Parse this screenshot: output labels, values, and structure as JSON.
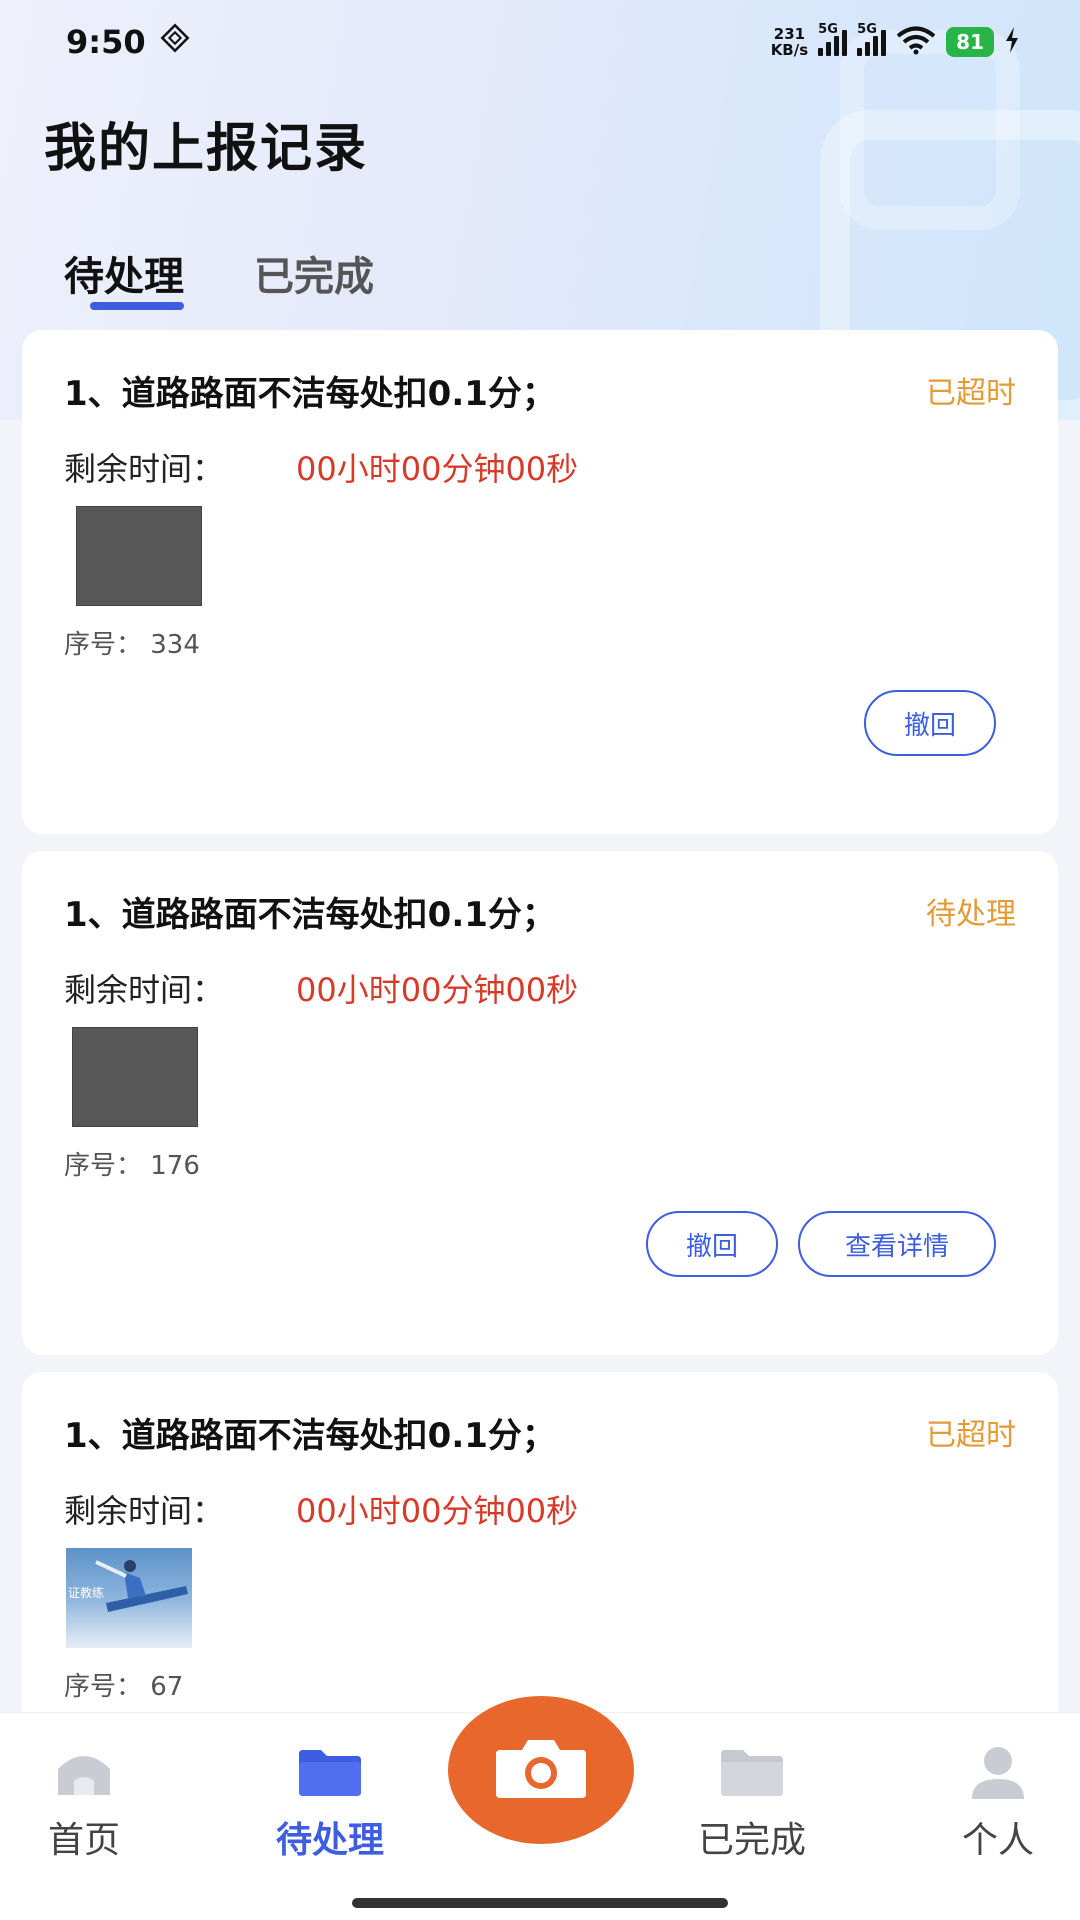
{
  "status_bar": {
    "time": "9:50",
    "speed_value": "231",
    "speed_unit": "KB/s",
    "sim1_label": "5G",
    "sim2_label": "5G",
    "battery": "81"
  },
  "page_title": "我的上报记录",
  "tabs": [
    {
      "label": "待处理",
      "active": true
    },
    {
      "label": "已完成",
      "active": false
    }
  ],
  "records": [
    {
      "title": "1、道路路面不洁每处扣0.1分；",
      "status": "已超时",
      "remaining_label": "剩余时间：",
      "remaining_value": "00小时00分钟00秒",
      "seq": "序号：  334",
      "actions": [
        "撤回"
      ]
    },
    {
      "title": "1、道路路面不洁每处扣0.1分；",
      "status": "待处理",
      "remaining_label": "剩余时间：",
      "remaining_value": "00小时00分钟00秒",
      "seq": "序号：  176",
      "actions": [
        "撤回",
        "查看详情"
      ]
    },
    {
      "title": "1、道路路面不洁每处扣0.1分；",
      "status": "已超时",
      "remaining_label": "剩余时间：",
      "remaining_value": "00小时00分钟00秒",
      "seq": "序号：  67",
      "thumb_text": "证教练"
    }
  ],
  "bottom_nav": [
    {
      "label": "首页",
      "icon": "home-icon"
    },
    {
      "label": "待处理",
      "icon": "folder-icon",
      "active": true
    },
    {
      "label": "",
      "icon": "camera-icon"
    },
    {
      "label": "已完成",
      "icon": "folder-icon"
    },
    {
      "label": "个人",
      "icon": "user-icon"
    }
  ],
  "colors": {
    "accent": "#3d5ee0",
    "status_orange": "#e49a35",
    "countdown_red": "#d83a2a",
    "camera_orange": "#e8672d"
  }
}
